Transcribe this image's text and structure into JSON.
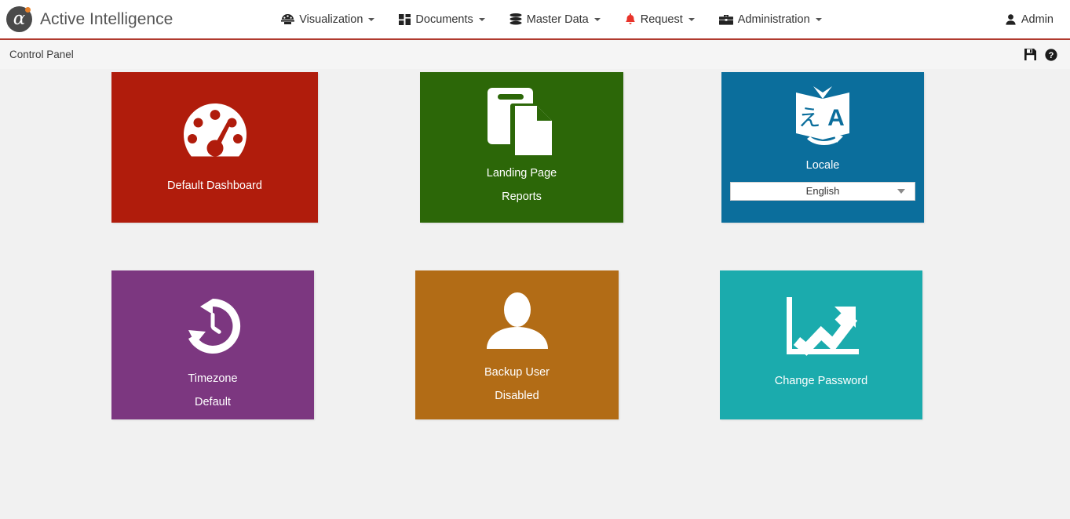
{
  "app": {
    "brand_title": "Active Intelligence",
    "logo_glyph": "α"
  },
  "navbar": {
    "items": [
      {
        "label": "Visualization",
        "icon": "dashboard-icon",
        "has_caret": true
      },
      {
        "label": "Documents",
        "icon": "documents-icon",
        "has_caret": true
      },
      {
        "label": "Master Data",
        "icon": "database-icon",
        "has_caret": true
      },
      {
        "label": "Request",
        "icon": "bell-icon",
        "has_caret": true
      },
      {
        "label": "Administration",
        "icon": "briefcase-icon",
        "has_caret": true
      }
    ],
    "user": {
      "label": "Admin",
      "icon": "user-icon"
    }
  },
  "subheader": {
    "title": "Control Panel",
    "actions": [
      {
        "name": "save-icon",
        "tooltip": "Save"
      },
      {
        "name": "help-icon",
        "tooltip": "Help"
      }
    ]
  },
  "tiles": [
    {
      "id": "dashboard",
      "label": "Default Dashboard",
      "sub": "",
      "icon": "gauge-icon",
      "color": "#b01c0c"
    },
    {
      "id": "landing",
      "label": "Landing Page",
      "sub": "Reports",
      "icon": "copy-documents-icon",
      "color": "#2c6708"
    },
    {
      "id": "locale",
      "label": "Locale",
      "sub": "",
      "icon": "translate-icon",
      "color": "#0b6e9c",
      "select": {
        "value": "English",
        "options": [
          "English"
        ]
      }
    },
    {
      "id": "timezone",
      "label": "Timezone",
      "sub": "Default",
      "icon": "clock-history-icon",
      "color": "#7c3780"
    },
    {
      "id": "backup",
      "label": "Backup User",
      "sub": "Disabled",
      "icon": "user-silhouette-icon",
      "color": "#b26c16"
    },
    {
      "id": "password",
      "label": "Change Password",
      "sub": "",
      "icon": "growth-chart-icon",
      "color": "#1babad"
    }
  ],
  "colors": {
    "accent_bar": "#b03a2e",
    "page_bg": "#f1f1f1",
    "navbar_bg": "#ffffff",
    "subbar_bg": "#f5f5f5"
  }
}
